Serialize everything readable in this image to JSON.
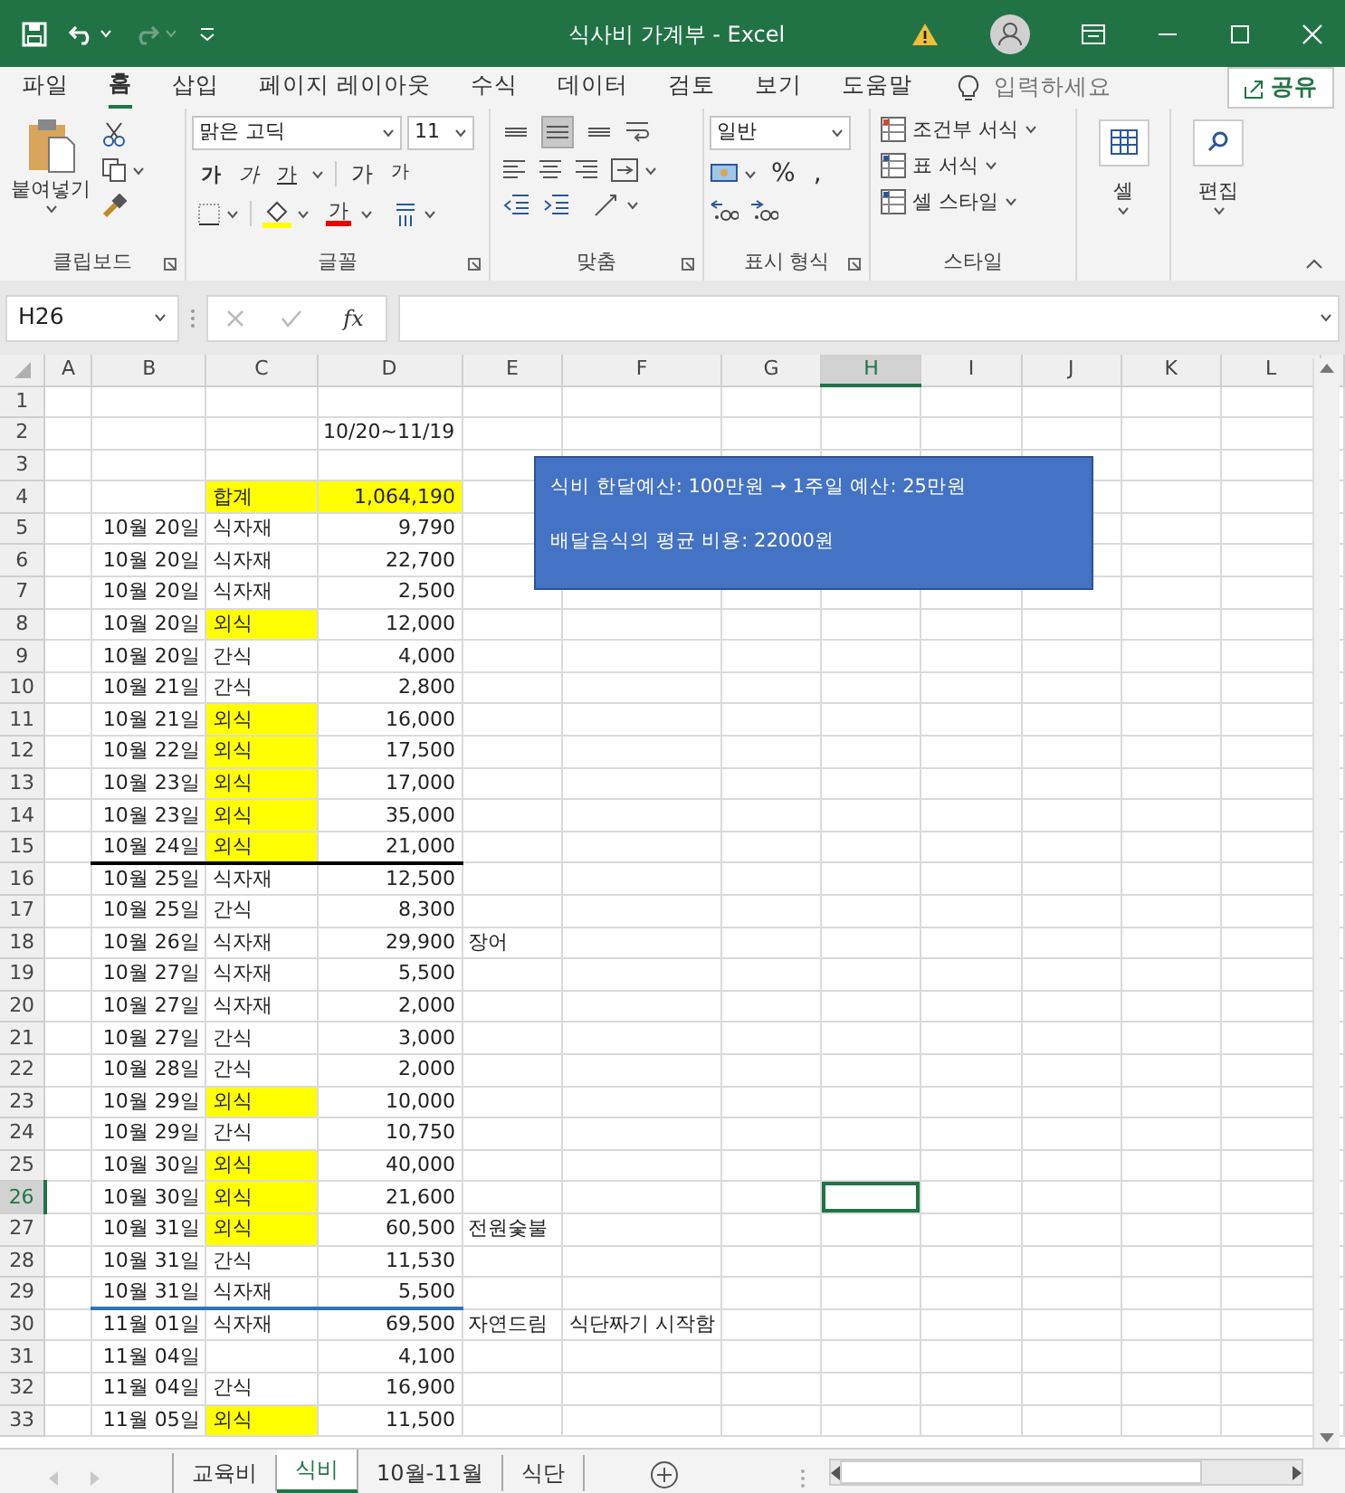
{
  "window": {
    "title": "식사비 가계부  -  Excel"
  },
  "menu_tabs": [
    {
      "label": "파일",
      "selected": false
    },
    {
      "label": "홈",
      "selected": true
    },
    {
      "label": "삽입",
      "selected": false
    },
    {
      "label": "페이지 레이아웃",
      "selected": false
    },
    {
      "label": "수식",
      "selected": false
    },
    {
      "label": "데이터",
      "selected": false
    },
    {
      "label": "검토",
      "selected": false
    },
    {
      "label": "보기",
      "selected": false
    },
    {
      "label": "도움말",
      "selected": false
    }
  ],
  "tell_me": {
    "placeholder": "입력하세요"
  },
  "share_button": "공유",
  "ribbon": {
    "paste_label": "붙여넣기",
    "font_name": "맑은 고딕",
    "font_size": "11",
    "font_buttons": [
      {
        "text": "가",
        "kind": "bold"
      },
      {
        "text": "가",
        "kind": "italic"
      },
      {
        "text": "가",
        "kind": "underline"
      }
    ],
    "size_buttons": [
      {
        "text": "가",
        "kind": "grow"
      },
      {
        "text": "가",
        "kind": "shrink"
      }
    ],
    "font_color_button": "가",
    "vertical_align": [
      {
        "kind": "top",
        "selected": false
      },
      {
        "kind": "middle",
        "selected": true
      },
      {
        "kind": "bottom",
        "selected": false
      }
    ],
    "number_format": "일반",
    "number_buttons": [
      "%",
      ","
    ],
    "style_buttons": [
      "조건부 서식",
      "표 서식",
      "셀 스타일"
    ],
    "cells_label": "셀",
    "editing_label": "편집",
    "group_labels": [
      "클립보드",
      "글꼴",
      "맞춤",
      "표시 형식",
      "스타일"
    ]
  },
  "formula_bar": {
    "name_box": "H26",
    "function_label": "fx"
  },
  "columns": [
    {
      "label": "A",
      "selected": false
    },
    {
      "label": "B",
      "selected": false
    },
    {
      "label": "C",
      "selected": false
    },
    {
      "label": "D",
      "selected": false
    },
    {
      "label": "E",
      "selected": false
    },
    {
      "label": "F",
      "selected": false
    },
    {
      "label": "G",
      "selected": false
    },
    {
      "label": "H",
      "selected": true
    },
    {
      "label": "I",
      "selected": false
    },
    {
      "label": "J",
      "selected": false
    },
    {
      "label": "K",
      "selected": false
    },
    {
      "label": "L",
      "selected": false
    }
  ],
  "rows": [
    {
      "row": "1",
      "selected": false
    },
    {
      "row": "2",
      "selected": false,
      "d": "10/20~11/19",
      "d_is_text": true
    },
    {
      "row": "3",
      "selected": false
    },
    {
      "row": "4",
      "selected": false,
      "c": "합계",
      "c_highlighted": true,
      "d": "1,064,190",
      "d_highlighted": true
    },
    {
      "row": "5",
      "selected": false,
      "b": "10월 20일",
      "c": "식자재",
      "d": "9,790"
    },
    {
      "row": "6",
      "selected": false,
      "b": "10월 20일",
      "c": "식자재",
      "d": "22,700"
    },
    {
      "row": "7",
      "selected": false,
      "b": "10월 20일",
      "c": "식자재",
      "d": "2,500"
    },
    {
      "row": "8",
      "selected": false,
      "b": "10월 20일",
      "c": "외식",
      "c_highlighted": true,
      "d": "12,000"
    },
    {
      "row": "9",
      "selected": false,
      "b": "10월 20일",
      "c": "간식",
      "d": "4,000"
    },
    {
      "row": "10",
      "selected": false,
      "b": "10월 21일",
      "c": "간식",
      "d": "2,800"
    },
    {
      "row": "11",
      "selected": false,
      "b": "10월 21일",
      "c": "외식",
      "c_highlighted": true,
      "d": "16,000"
    },
    {
      "row": "12",
      "selected": false,
      "b": "10월 22일",
      "c": "외식",
      "c_highlighted": true,
      "d": "17,500"
    },
    {
      "row": "13",
      "selected": false,
      "b": "10월 23일",
      "c": "외식",
      "c_highlighted": true,
      "d": "17,000"
    },
    {
      "row": "14",
      "selected": false,
      "b": "10월 23일",
      "c": "외식",
      "c_highlighted": true,
      "d": "35,000"
    },
    {
      "row": "15",
      "selected": false,
      "b": "10월 24일",
      "c": "외식",
      "c_highlighted": true,
      "d": "21,000",
      "rule_below": {
        "color": "#000000"
      }
    },
    {
      "row": "16",
      "selected": false,
      "b": "10월 25일",
      "c": "식자재",
      "d": "12,500"
    },
    {
      "row": "17",
      "selected": false,
      "b": "10월 25일",
      "c": "간식",
      "d": "8,300"
    },
    {
      "row": "18",
      "selected": false,
      "b": "10월 26일",
      "c": "식자재",
      "d": "29,900",
      "e": "장어"
    },
    {
      "row": "19",
      "selected": false,
      "b": "10월 27일",
      "c": "식자재",
      "d": "5,500"
    },
    {
      "row": "20",
      "selected": false,
      "b": "10월 27일",
      "c": "식자재",
      "d": "2,000"
    },
    {
      "row": "21",
      "selected": false,
      "b": "10월 27일",
      "c": "간식",
      "d": "3,000"
    },
    {
      "row": "22",
      "selected": false,
      "b": "10월 28일",
      "c": "간식",
      "d": "2,000"
    },
    {
      "row": "23",
      "selected": false,
      "b": "10월 29일",
      "c": "외식",
      "c_highlighted": true,
      "d": "10,000"
    },
    {
      "row": "24",
      "selected": false,
      "b": "10월 29일",
      "c": "간식",
      "d": "10,750"
    },
    {
      "row": "25",
      "selected": false,
      "b": "10월 30일",
      "c": "외식",
      "c_highlighted": true,
      "d": "40,000"
    },
    {
      "row": "26",
      "selected": true,
      "b": "10월 30일",
      "c": "외식",
      "c_highlighted": true,
      "d": "21,600"
    },
    {
      "row": "27",
      "selected": false,
      "b": "10월 31일",
      "c": "외식",
      "c_highlighted": true,
      "d": "60,500",
      "e": "전원숯불"
    },
    {
      "row": "28",
      "selected": false,
      "b": "10월 31일",
      "c": "간식",
      "d": "11,530"
    },
    {
      "row": "29",
      "selected": false,
      "b": "10월 31일",
      "c": "식자재",
      "d": "5,500",
      "rule_below": {
        "color": "#2e75b6"
      }
    },
    {
      "row": "30",
      "selected": false,
      "b": "11월 01일",
      "c": "식자재",
      "d": "69,500",
      "e": "자연드림",
      "f": "식단짜기 시작함"
    },
    {
      "row": "31",
      "selected": false,
      "b": "11월 04일",
      "d": "4,100"
    },
    {
      "row": "32",
      "selected": false,
      "b": "11월 04일",
      "c": "간식",
      "d": "16,900"
    },
    {
      "row": "33",
      "selected": false,
      "b": "11월 05일",
      "c": "외식",
      "c_highlighted": true,
      "d": "11,500"
    }
  ],
  "text_box": {
    "lines": [
      "식비 한달예산: 100만원  → 1주일 예산: 25만원",
      "배달음식의 평균 비용: 22000원"
    ]
  },
  "sheet_tabs": [
    {
      "label": "교육비",
      "selected": false
    },
    {
      "label": "식비",
      "selected": true
    },
    {
      "label": "10월-11월",
      "selected": false
    },
    {
      "label": "식단",
      "selected": false
    }
  ]
}
